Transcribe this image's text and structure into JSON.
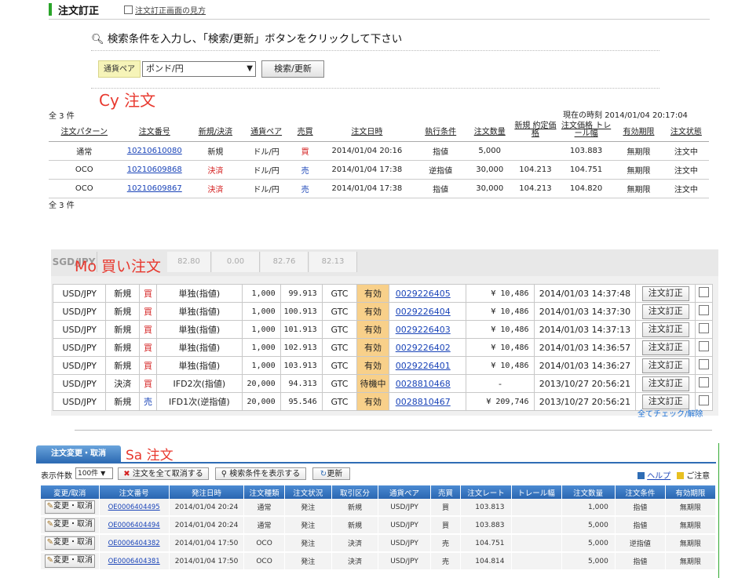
{
  "section1": {
    "title": "注文訂正",
    "help_link": "注文訂正画面の見方",
    "instruction": "検索条件を入力し、「検索/更新」ボタンをクリックして下さい",
    "filter": {
      "label": "通貨ペア",
      "selected": "ポンド/円",
      "button": "検索/更新"
    },
    "annotation": "Cy 注文",
    "count_top": "全 3 件",
    "count_bottom": "全 3 件",
    "current_time_label": "現在の時刻",
    "current_time": "2014/01/04 20:17:04",
    "columns": [
      "注文パターン",
      "注文番号",
      "新規/決済",
      "通貨ペア",
      "売買",
      "注文日時",
      "執行条件",
      "注文数量",
      "新規 約定価格",
      "注文価格 トレール幅",
      "有効期限",
      "注文状態"
    ],
    "rows": [
      {
        "pattern": "通常",
        "order_no": "10210610080",
        "type": "新規",
        "pair": "ドル/円",
        "side": "買",
        "datetime": "2014/01/04 20:16",
        "cond": "指値",
        "qty": "5,000",
        "fill_price": "",
        "price": "103.883",
        "expiry": "無期限",
        "status": "注文中"
      },
      {
        "pattern": "OCO",
        "order_no": "10210609868",
        "type": "決済",
        "pair": "ドル/円",
        "side": "売",
        "datetime": "2014/01/04 17:38",
        "cond": "逆指値",
        "qty": "30,000",
        "fill_price": "104.213",
        "price": "104.751",
        "expiry": "無期限",
        "status": "注文中"
      },
      {
        "pattern": "OCO",
        "order_no": "10210609867",
        "type": "決済",
        "pair": "ドル/円",
        "side": "売",
        "datetime": "2014/01/04 17:38",
        "cond": "指値",
        "qty": "30,000",
        "fill_price": "104.213",
        "price": "104.820",
        "expiry": "無期限",
        "status": "注文中"
      }
    ]
  },
  "section2": {
    "annotation": "Mo 買い注文",
    "top_row": [
      "SGD/JPY",
      "82.80",
      "0.00",
      "82.76",
      "82.13"
    ],
    "rows": [
      {
        "pair": "USD/JPY",
        "type": "新規",
        "side": "買",
        "kind": "単独(指値)",
        "qty": "1,000",
        "price": "99.913",
        "tif": "GTC",
        "state": "有効",
        "order_no": "0029226405",
        "margin": "¥ 10,486",
        "datetime": "2014/01/03 14:37:48",
        "btn": "注文訂正"
      },
      {
        "pair": "USD/JPY",
        "type": "新規",
        "side": "買",
        "kind": "単独(指値)",
        "qty": "1,000",
        "price": "100.913",
        "tif": "GTC",
        "state": "有効",
        "order_no": "0029226404",
        "margin": "¥ 10,486",
        "datetime": "2014/01/03 14:37:30",
        "btn": "注文訂正"
      },
      {
        "pair": "USD/JPY",
        "type": "新規",
        "side": "買",
        "kind": "単独(指値)",
        "qty": "1,000",
        "price": "101.913",
        "tif": "GTC",
        "state": "有効",
        "order_no": "0029226403",
        "margin": "¥ 10,486",
        "datetime": "2014/01/03 14:37:13",
        "btn": "注文訂正"
      },
      {
        "pair": "USD/JPY",
        "type": "新規",
        "side": "買",
        "kind": "単独(指値)",
        "qty": "1,000",
        "price": "102.913",
        "tif": "GTC",
        "state": "有効",
        "order_no": "0029226402",
        "margin": "¥ 10,486",
        "datetime": "2014/01/03 14:36:57",
        "btn": "注文訂正"
      },
      {
        "pair": "USD/JPY",
        "type": "新規",
        "side": "買",
        "kind": "単独(指値)",
        "qty": "1,000",
        "price": "103.913",
        "tif": "GTC",
        "state": "有効",
        "order_no": "0029226401",
        "margin": "¥ 10,486",
        "datetime": "2014/01/03 14:36:27",
        "btn": "注文訂正"
      },
      {
        "pair": "USD/JPY",
        "type": "決済",
        "side": "買",
        "kind": "IFD2次(指値)",
        "qty": "20,000",
        "price": "94.313",
        "tif": "GTC",
        "state": "待機中",
        "order_no": "0028810468",
        "margin": "-",
        "datetime": "2013/10/27 20:56:21",
        "btn": "注文訂正"
      },
      {
        "pair": "USD/JPY",
        "type": "新規",
        "side": "売",
        "kind": "IFD1次(逆指値)",
        "qty": "20,000",
        "price": "95.546",
        "tif": "GTC",
        "state": "有効",
        "order_no": "0028810467",
        "margin": "¥ 209,746",
        "datetime": "2013/10/27 20:56:21",
        "btn": "注文訂正"
      }
    ],
    "check_all": "全てチェック/解除"
  },
  "section3": {
    "tab": "注文変更・取消",
    "annotation": "Sa 注文",
    "per_page_label": "表示件数",
    "per_page_value": "100件",
    "cancel_all": "注文を全て取消する",
    "show_conditions": "検索条件を表示する",
    "refresh": "更新",
    "help": "ヘルプ",
    "notice": "ご注意",
    "columns": [
      "変更/取消",
      "注文番号",
      "発注日時",
      "注文種類",
      "注文状況",
      "取引区分",
      "通貨ペア",
      "売買",
      "注文レート",
      "トレール幅",
      "注文数量",
      "注文条件",
      "有効期限"
    ],
    "rows": [
      {
        "btn": "変更・取消",
        "order_no": "OE0006404495",
        "datetime": "2014/01/04 20:24",
        "kind": "通常",
        "state": "発注",
        "class": "新規",
        "pair": "USD/JPY",
        "side": "買",
        "rate": "103.813",
        "trail": "",
        "qty": "1,000",
        "cond": "指値",
        "expiry": "無期限"
      },
      {
        "btn": "変更・取消",
        "order_no": "OE0006404494",
        "datetime": "2014/01/04 20:24",
        "kind": "通常",
        "state": "発注",
        "class": "新規",
        "pair": "USD/JPY",
        "side": "買",
        "rate": "103.883",
        "trail": "",
        "qty": "5,000",
        "cond": "指値",
        "expiry": "無期限"
      },
      {
        "btn": "変更・取消",
        "order_no": "OE0006404382",
        "datetime": "2014/01/04 17:50",
        "kind": "OCO",
        "state": "発注",
        "class": "決済",
        "pair": "USD/JPY",
        "side": "売",
        "rate": "104.751",
        "trail": "",
        "qty": "5,000",
        "cond": "逆指値",
        "expiry": "無期限"
      },
      {
        "btn": "変更・取消",
        "order_no": "OE0006404381",
        "datetime": "2014/01/04 17:50",
        "kind": "OCO",
        "state": "発注",
        "class": "決済",
        "pair": "USD/JPY",
        "side": "売",
        "rate": "104.814",
        "trail": "",
        "qty": "5,000",
        "cond": "指値",
        "expiry": "無期限"
      }
    ]
  }
}
